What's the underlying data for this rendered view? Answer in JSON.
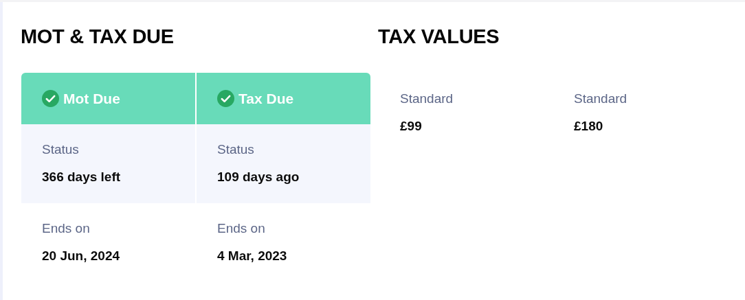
{
  "mot_tax_due": {
    "title": "MOT & TAX DUE",
    "columns": [
      {
        "title": "Mot Due",
        "status_label": "Status",
        "status": "366 days left",
        "ends_label": "Ends on",
        "ends": "20 Jun, 2024"
      },
      {
        "title": "Tax Due",
        "status_label": "Status",
        "status": "109 days ago",
        "ends_label": "Ends on",
        "ends": "4 Mar, 2023"
      }
    ]
  },
  "tax_values": {
    "title": "TAX VALUES",
    "items": [
      {
        "label": "Standard",
        "value": "£99"
      },
      {
        "label": "Standard",
        "value": "£180"
      }
    ]
  }
}
